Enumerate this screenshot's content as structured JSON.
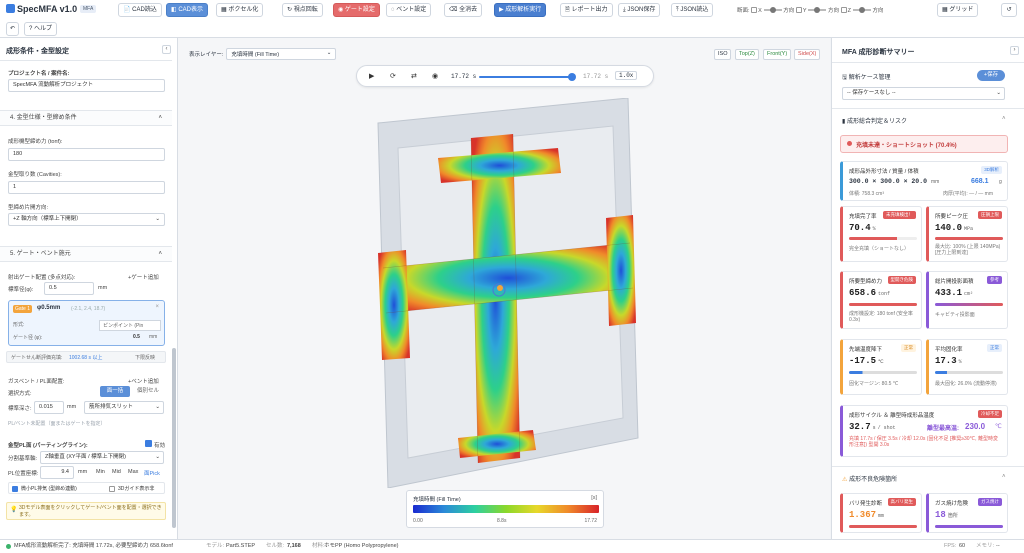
{
  "app": {
    "title": "SpecMFA v1.0",
    "badge": "MFA"
  },
  "toolbar": {
    "cad_import": "CAD読込",
    "cad_view": "CAD表示",
    "voxel": "ボクセル化",
    "rotate": "視点回転",
    "gate": "ゲート設定",
    "vent": "ベント設定",
    "clear": "全消去",
    "run": "成形解析実行",
    "report": "レポート出力",
    "json_save": "JSON保存",
    "json_load": "JSON読込",
    "section_label": "断面:",
    "x_label": "X",
    "y_label": "Y",
    "z_label": "Z",
    "pos_label": "方向",
    "grid": "グリッド",
    "help": "ヘルプ"
  },
  "left": {
    "title": "成形条件・金型設定",
    "project_label": "プロジェクト名 / 案件名:",
    "project_value": "SpecMFA 流動解析プロジェクト",
    "sec4": "4. 金型仕様・型締め条件",
    "clamp_label": "成形機型締め力 (tonf):",
    "clamp_value": "180",
    "cav_label": "金型取り数 (Cavities):",
    "cav_value": "1",
    "open_label": "型締め片開方向:",
    "open_value": "+Z 軸方向（標準上下開閉）",
    "sec5": "5. ゲート・ベント施元",
    "gate_label": "射出ゲート配置 (多点対応):",
    "gate_add": "+ゲート追加",
    "std_dia_label": "標準径(φ):",
    "std_dia_value": "0.5",
    "std_dia_unit": "mm",
    "gate_tag": "Gate 1",
    "gate_dia": "φ0.5mm",
    "gate_coords": "(-2.1, 2.4, 18.7)",
    "form_label": "形式:",
    "form_value": "ピンポイント (Pin",
    "gdia_label": "ゲート径 (φ):",
    "gdia_value": "0.5",
    "gate_note": "ゲートせん断評価充填:",
    "gate_note_val": "1002.68 s 以上",
    "gate_note2": "下限反映",
    "vent_label": "ガスベント / PL面配置:",
    "vent_add": "+ベント追加",
    "sel_method": "選択方式:",
    "sel_a": "面一括",
    "sel_b": "個別セル",
    "depth_label": "標準深さ:",
    "depth_value": "0.015",
    "depth_unit": "mm",
    "depth_type": "筋所排気スリット",
    "pl_hint": "PL/ベント未配置（面またはゲートを指定）",
    "mold_pl": "金型PL面 (パーティングライン):",
    "mold_pl_on": "有効",
    "split_dir_label": "分割基準軸:",
    "split_dir_value": "Z軸垂直 (XY平面 / 標準上下開閉)",
    "pl_pos_label": "PL位置座標:",
    "pl_pos_value": "9.4",
    "pl_pos_unit": "mm",
    "min": "Min",
    "mid": "Mid",
    "max": "Max",
    "pick": "面Pick",
    "auto_pl": "微小PL排気 (型締め連動)",
    "guide": "3Dガイド表示非",
    "hint": "3Dモデル表面をクリックしてゲート/ベント面を配置・選択できます。"
  },
  "center": {
    "layer_label": "表示レイヤー:",
    "layer_value": "充填時間 (Fill Time)",
    "views": [
      "ISO",
      "Top(Z)",
      "Front(Y)",
      "Side(X)"
    ],
    "time_cur": "17.72 s",
    "time_total": "17.72 s",
    "speed": "1.0x",
    "legend_title": "充填時間 (Fill Time)",
    "legend_unit": "[s]",
    "legend_min": "0.00",
    "legend_mid": "8.8s",
    "legend_max": "17.72"
  },
  "right": {
    "title": "MFA 成形診断サマリー",
    "case_label": "解析ケース管理",
    "case_save": "+保存",
    "case_select": "-- 保存ケースなし --",
    "judge": "成形総合判定＆リスク",
    "alert": "充填未達・ショートショット (70.4%)",
    "dim_title": "成形品外形寸法 / 質量 / 体積",
    "dim_value": "300.0 × 300.0 × 20.0",
    "dim_unit": "mm",
    "dim_tag": "3D解析",
    "mass": "668.1",
    "mass_unit": "g",
    "vol": "体積: 758.3 cm³",
    "thick": "肉厚(平均): — / — mm",
    "c1_title": "充填完了率",
    "c1_badge": "未充填検出！",
    "c1_value": "70.4",
    "c1_unit": "%",
    "c1_sub": "完全充填（ショートなし）",
    "c2_title": "所要ピーク圧",
    "c2_badge": "圧損上限",
    "c2_value": "140.0",
    "c2_unit": "MPa",
    "c2_sub": "最大比: 100% (上限 140MPa) [圧力上限到達]",
    "c3_title": "所要型締め力",
    "c3_badge": "型開き危険",
    "c3_value": "658.6",
    "c3_unit": "tonf",
    "c3_sub": "成形機設定: 180 tonf (安全率 0.3x)",
    "c4_title": "総片開投影面積",
    "c4_badge": "参考",
    "c4_value": "433.1",
    "c4_unit": "cm²",
    "c4_sub": "キャビティ投影面",
    "c5_title": "先端温度降下",
    "c5_badge": "正常",
    "c5_value": "-17.5",
    "c5_unit": "℃",
    "c5_sub": "固化マージン: 80.5 ℃",
    "c6_title": "平均固化率",
    "c6_badge": "正常",
    "c6_value": "17.3",
    "c6_unit": "%",
    "c6_sub": "最大固化: 26.0% (流動停滞)",
    "c7_title": "成形サイクル ＆ 離型時成形品温度",
    "c7_badge": "冷却不足",
    "c7_value": "32.7",
    "c7_unit": "s",
    "c7_per": "/ shot",
    "c7_temp_label": "離型最高温:",
    "c7_temp": "230.0",
    "c7_temp_unit": "℃",
    "c7_sub": "充填 17.7s / 保圧 3.5s / 冷却 12.0s (固化不足 [推奨≥30℃, 離型時変形注意]) 型開 3.0s",
    "risk": "成形不良危険箇所",
    "r1_title": "バリ発生診断",
    "r1_badge": "高バリ発生",
    "r1_value": "1.367",
    "r1_unit": "mm",
    "r2_title": "ガス焼け危険",
    "r2_badge": "ガス焼け",
    "r2_value": "18",
    "r2_unit": "箇所"
  },
  "status": {
    "msg": "MFA成形流動解析完了: 充填時間 17.72s, 必要型締め力 658.6tonf",
    "model_label": "モデル:",
    "model": "Part5.STEP",
    "cell_label": "セル数:",
    "cells": "7,168",
    "mat_label": "材料:",
    "mat": "ホモPP (Homo Polypropylene)",
    "fps_label": "FPS:",
    "fps": "60",
    "mem_label": "メモリ:",
    "mem": "--"
  },
  "colors": {
    "accent": "#3b7de0",
    "danger": "#e05a5a",
    "warn": "#f3a43c",
    "ok": "#3bb36b"
  }
}
